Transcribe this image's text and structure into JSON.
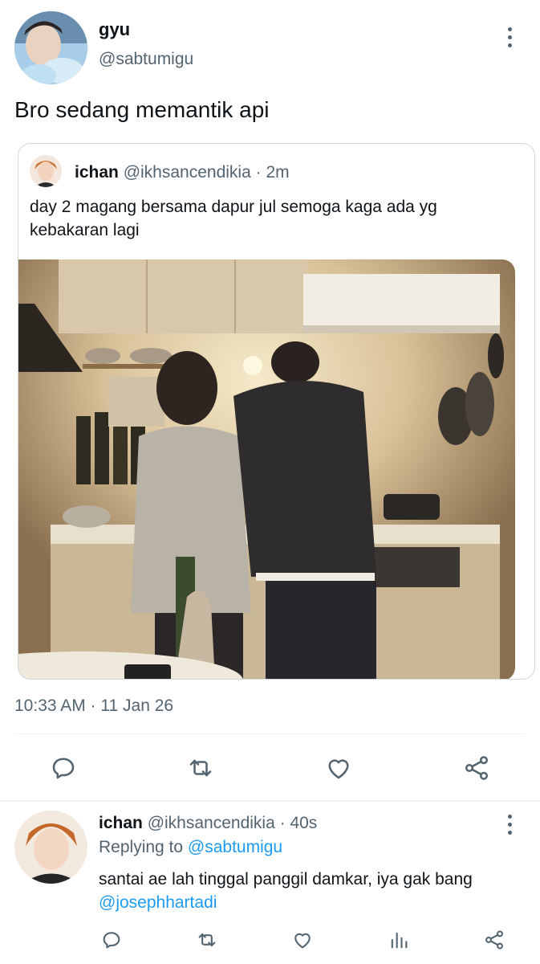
{
  "tweet": {
    "author_name": "gyu",
    "author_handle": "@sabtumigu",
    "text": "Bro sedang memantik api",
    "timestamp": "10:33 AM · 11 Jan 26",
    "quoted": {
      "author_name": "ichan",
      "author_handle": "@ikhsancendikia",
      "time_ago": "· 2m",
      "text": "day 2 magang bersama dapur jul semoga kaga ada yg kebakaran lagi"
    },
    "actions": [
      "reply-icon",
      "retweet-icon",
      "like-icon",
      "share-icon"
    ]
  },
  "reply": {
    "author_name": "ichan",
    "author_handle": "@ikhsancendikia",
    "time_ago": "· 40s",
    "replying_label": "Replying to",
    "replying_handle": "@sabtumigu",
    "text": "santai ae lah tinggal panggil damkar, iya gak bang",
    "mention": "@josephhartadi",
    "actions": [
      "reply-icon",
      "retweet-icon",
      "like-icon",
      "views-icon",
      "share-icon"
    ]
  },
  "colors": {
    "link": "#1d9bf0",
    "secondary_text": "#536471",
    "divider": "#eff3f4"
  }
}
